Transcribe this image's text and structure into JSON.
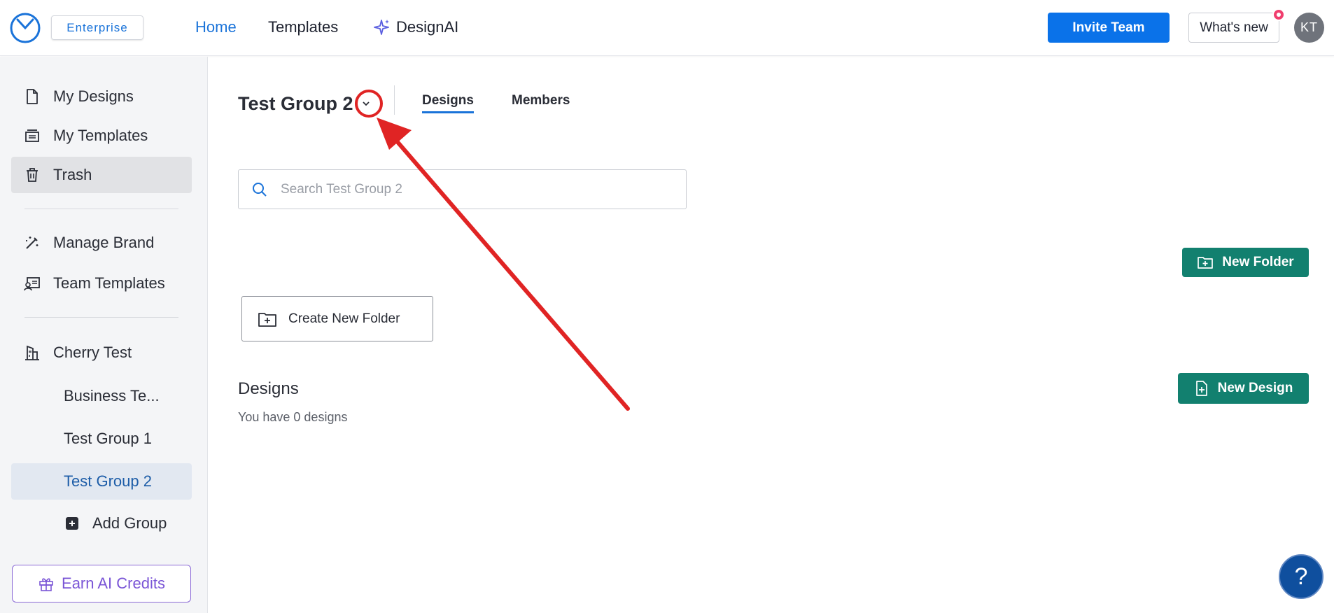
{
  "header": {
    "badge": "Enterprise",
    "nav": {
      "home": "Home",
      "templates": "Templates",
      "designai": "DesignAI"
    },
    "invite_button": "Invite Team",
    "whats_new_button": "What's new",
    "avatar_initials": "KT",
    "accent_color": "#0a72e9"
  },
  "sidebar": {
    "my_designs": "My Designs",
    "my_templates": "My Templates",
    "trash": "Trash",
    "manage_brand": "Manage Brand",
    "team_templates": "Team Templates",
    "workspace": "Cherry Test",
    "groups": [
      "Business Te...",
      "Test Group 1",
      "Test Group 2"
    ],
    "add_group": "Add Group",
    "earn_credits": "Earn AI Credits"
  },
  "main": {
    "group_title": "Test Group 2",
    "tabs": {
      "designs": "Designs",
      "members": "Members"
    },
    "search_placeholder": "Search Test Group 2",
    "new_folder_button": "New Folder",
    "create_folder_card": "Create New Folder",
    "designs_title": "Designs",
    "designs_count_text": "You have 0 designs",
    "new_design_button": "New Design",
    "action_color": "#12806f"
  },
  "help_button": "?"
}
